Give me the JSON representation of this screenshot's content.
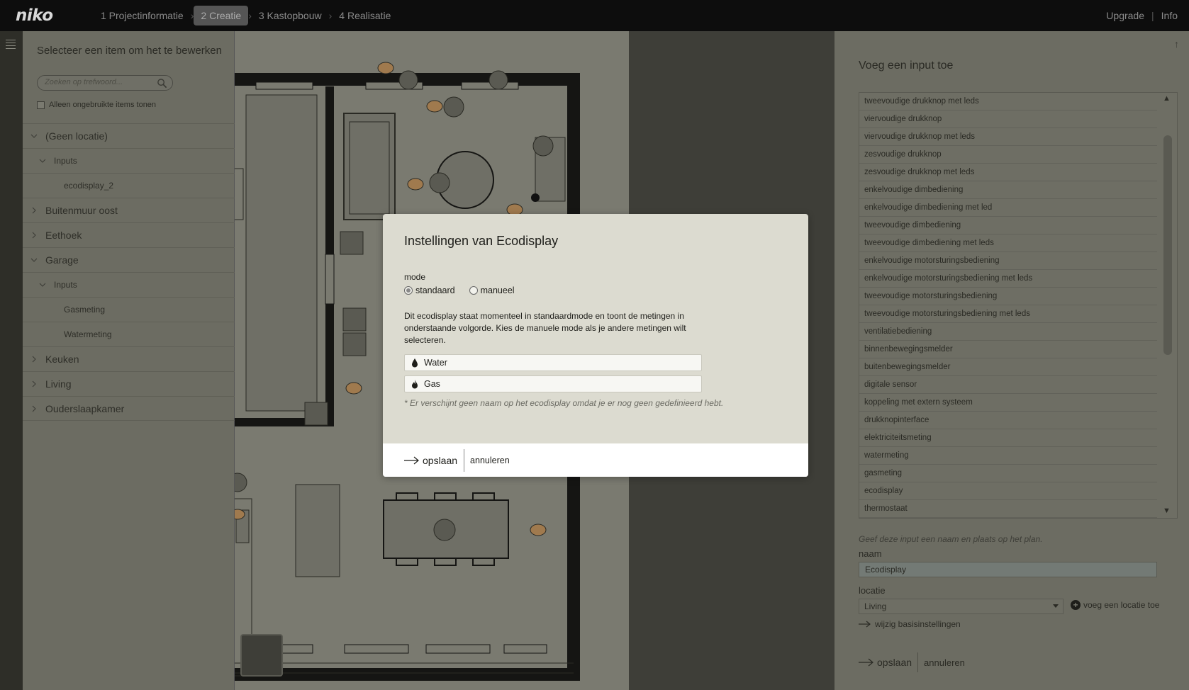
{
  "app": {
    "logo": "niko"
  },
  "nav": {
    "steps": [
      {
        "label": "1 Projectinformatie"
      },
      {
        "label": "2 Creatie"
      },
      {
        "label": "3 Kastopbouw"
      },
      {
        "label": "4 Realisatie"
      }
    ],
    "upgrade": "Upgrade",
    "sep": "|",
    "info": "Info"
  },
  "left_panel": {
    "title": "Selecteer een item om het te bewerken",
    "search_placeholder": "Zoeken op trefwoord...",
    "only_unused_label": "Alleen ongebruikte items tonen",
    "tree": [
      {
        "label": "(Geen locatie)"
      },
      {
        "label": "Inputs"
      },
      {
        "label": "ecodisplay_2"
      },
      {
        "label": "Buitenmuur oost"
      },
      {
        "label": "Eethoek"
      },
      {
        "label": "Garage"
      },
      {
        "label": "Inputs"
      },
      {
        "label": "Gasmeting"
      },
      {
        "label": "Watermeting"
      },
      {
        "label": "Keuken"
      },
      {
        "label": "Living"
      },
      {
        "label": "Ouderslaapkamer"
      }
    ]
  },
  "modal": {
    "title": "Instellingen van Ecodisplay",
    "mode_label": "mode",
    "mode_options": [
      "standaard",
      "manueel"
    ],
    "mode_selected": "standaard",
    "description": "Dit ecodisplay staat momenteel in standaardmode en toont de metingen in onderstaande volgorde. Kies de manuele mode als je andere metingen wilt selecteren.",
    "measurements": [
      "Water",
      "Gas"
    ],
    "note": "* Er verschijnt geen naam op het ecodisplay omdat je er nog geen gedefinieerd hebt.",
    "save_label": "opslaan",
    "cancel_label": "annuleren"
  },
  "right_panel": {
    "title": "Voeg een input toe",
    "items": [
      "tweevoudige drukknop met leds",
      "viervoudige drukknop",
      "viervoudige drukknop met leds",
      "zesvoudige drukknop",
      "zesvoudige drukknop met leds",
      "enkelvoudige dimbediening",
      "enkelvoudige dimbediening met led",
      "tweevoudige dimbediening",
      "tweevoudige dimbediening met leds",
      "enkelvoudige motorsturingsbediening",
      "enkelvoudige motorsturingsbediening met leds",
      "tweevoudige motorsturingsbediening",
      "tweevoudige motorsturingsbediening met leds",
      "ventilatiebediening",
      "binnenbewegingsmelder",
      "buitenbewegingsmelder",
      "digitale sensor",
      "koppeling met extern systeem",
      "drukknopinterface",
      "elektriciteitsmeting",
      "watermeting",
      "gasmeting",
      "ecodisplay",
      "thermostaat"
    ],
    "hint": "Geef deze input een naam en plaats op het plan.",
    "name_label": "naam",
    "name_value": "Ecodisplay",
    "location_label": "locatie",
    "location_value": "Living",
    "add_location": "voeg een locatie toe",
    "basic_settings_link": "wijzig basisinstellingen",
    "save_label": "opslaan",
    "cancel_label": "annuleren"
  }
}
